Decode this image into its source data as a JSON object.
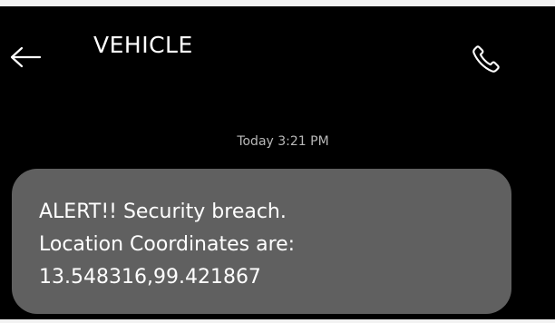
{
  "header": {
    "title": "VEHICLE",
    "back_icon": "arrow-left-icon",
    "call_icon": "phone-icon"
  },
  "conversation": {
    "timestamp": "Today 3:21 PM",
    "message": {
      "lines": [
        "ALERT!! Security breach.",
        "Location Coordinates are:",
        "13.548316,99.421867"
      ]
    }
  },
  "colors": {
    "background": "#000000",
    "bubble": "#606060",
    "text_primary": "#ffffff",
    "text_secondary": "#b8b8b8"
  }
}
